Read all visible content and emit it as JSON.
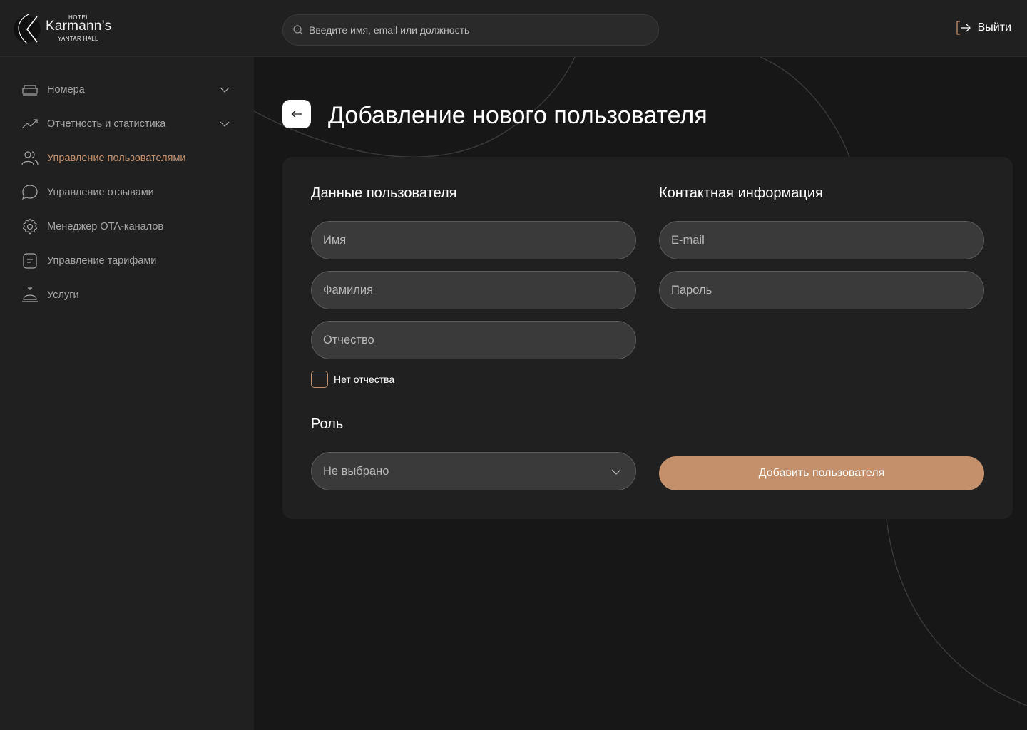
{
  "logo": {
    "hotel": "HOTEL",
    "brand": "Karmann’s",
    "sub": "YANTAR HALL"
  },
  "search": {
    "placeholder": "Введите имя, email или должность",
    "icon": "search-icon"
  },
  "logout": {
    "label": "Выйти",
    "icon": "logout-icon"
  },
  "sidebar": {
    "items": [
      {
        "label": "Номера",
        "icon": "bed-icon",
        "expandable": true
      },
      {
        "label": "Отчетность и статистика",
        "icon": "trend-icon",
        "expandable": true
      },
      {
        "label": "Управление пользователями",
        "icon": "users-icon",
        "active": true
      },
      {
        "label": "Управление отзывами",
        "icon": "chat-icon"
      },
      {
        "label": "Менеджер OTA-каналов",
        "icon": "gear-icon"
      },
      {
        "label": "Управление тарифами",
        "icon": "document-icon"
      },
      {
        "label": "Услуги",
        "icon": "service-bell-icon"
      }
    ]
  },
  "page": {
    "title": "Добавление нового пользователя"
  },
  "form": {
    "user_section": "Данные пользователя",
    "contact_section": "Контактная информация",
    "role_section": "Роль",
    "first_name_placeholder": "Имя",
    "last_name_placeholder": "Фамилия",
    "patronymic_placeholder": "Отчество",
    "no_patronymic_label": "Нет отчества",
    "no_patronymic_checked": false,
    "email_placeholder": "E-mail",
    "password_placeholder": "Пароль",
    "role_value": "Не выбрано",
    "submit_label": "Добавить пользователя"
  },
  "colors": {
    "accent": "#c4906c",
    "background": "#171717",
    "panel": "#202020",
    "field": "#3a3a3a"
  }
}
